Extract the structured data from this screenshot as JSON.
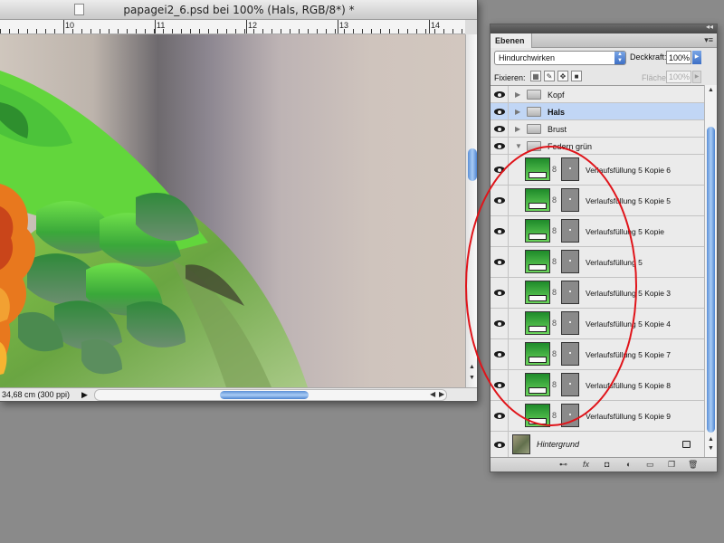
{
  "document": {
    "title": "papagei2_6.psd bei 100% (Hals, RGB/8*) *",
    "ruler_numbers": [
      "10",
      "11",
      "12",
      "13",
      "14"
    ],
    "status_text": "34,68 cm (300 ppi)",
    "status_arrow": "▶"
  },
  "panel": {
    "tab_label": "Ebenen",
    "blend_mode": "Hindurchwirken",
    "opacity_label": "Deckkraft:",
    "opacity_value": "100%",
    "lock_label": "Fixieren:",
    "fill_label": "Fläche:",
    "fill_value": "100%",
    "groups": [
      {
        "name": "Kopf",
        "selected": false,
        "expanded": false
      },
      {
        "name": "Hals",
        "selected": true,
        "expanded": false
      },
      {
        "name": "Brust",
        "selected": false,
        "expanded": false
      },
      {
        "name": "Federn grün",
        "selected": false,
        "expanded": true
      }
    ],
    "layers": [
      "Verlaufsfüllung 5 Kopie 6",
      "Verlaufsfüllung 5 Kopie 5",
      "Verlaufsfüllung 5 Kopie",
      "Verlaufsfüllung 5",
      "Verlaufsfüllung 5 Kopie 3",
      "Verlaufsfüllung 5 Kopie 4",
      "Verlaufsfüllung 5 Kopie 7",
      "Verlaufsfüllung 5 Kopie 8",
      "Verlaufsfüllung 5 Kopie 9"
    ],
    "background_layer": "Hintergrund",
    "footer_buttons": [
      "link-icon",
      "fx-icon",
      "mask-icon",
      "adjustment-icon",
      "folder-icon",
      "new-layer-icon",
      "trash-icon"
    ]
  },
  "colors": {
    "selection": "#c1d6f5",
    "annotation": "#e0141a",
    "scroll_thumb": "#6f9fe0"
  }
}
